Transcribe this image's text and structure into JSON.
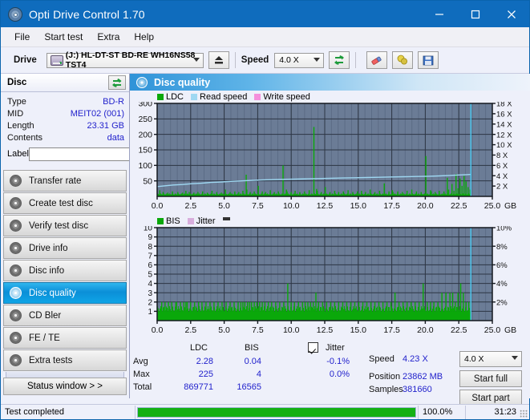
{
  "window": {
    "title": "Opti Drive Control 1.70",
    "icon": "disc-icon",
    "minimize": "minimize-icon",
    "maximize": "maximize-icon",
    "close": "close-icon"
  },
  "menu": {
    "items": [
      "File",
      "Start test",
      "Extra",
      "Help"
    ]
  },
  "toolbar": {
    "drive_label": "Drive",
    "drive_value": "(J:)  HL-DT-ST BD-RE  WH16NS58 TST4",
    "eject_icon": "eject-icon",
    "speed_label": "Speed",
    "speed_value": "4.0 X",
    "refresh_icon": "refresh-icon",
    "erase_icon": "eraser-icon",
    "tools_icon": "bulb-icon",
    "save_icon": "save-icon"
  },
  "disc": {
    "header": "Disc",
    "refresh_icon": "refresh-icon",
    "rows": [
      {
        "key": "Type",
        "value": "BD-R"
      },
      {
        "key": "MID",
        "value": "MEIT02 (001)"
      },
      {
        "key": "Length",
        "value": "23.31 GB"
      },
      {
        "key": "Contents",
        "value": "data"
      }
    ],
    "label_key": "Label",
    "label_value": "",
    "label_placeholder": "",
    "label_button_icon": "cd-icon"
  },
  "nav": {
    "items": [
      {
        "label": "Transfer rate",
        "icon": "disc-icon",
        "active": false
      },
      {
        "label": "Create test disc",
        "icon": "disc-icon",
        "active": false
      },
      {
        "label": "Verify test disc",
        "icon": "disc-icon",
        "active": false
      },
      {
        "label": "Drive info",
        "icon": "disc-icon",
        "active": false
      },
      {
        "label": "Disc info",
        "icon": "disc-icon",
        "active": false
      },
      {
        "label": "Disc quality",
        "icon": "disc-icon",
        "active": true
      },
      {
        "label": "CD Bler",
        "icon": "disc-icon",
        "active": false
      },
      {
        "label": "FE / TE",
        "icon": "disc-icon",
        "active": false
      },
      {
        "label": "Extra tests",
        "icon": "disc-icon",
        "active": false
      }
    ],
    "status_window": "Status window > >"
  },
  "panel": {
    "title": "Disc quality",
    "icon": "disc-icon"
  },
  "chart_data": [
    {
      "type": "line",
      "name": "ldc-chart",
      "title": "",
      "xlabel": "GB",
      "ylabel": "",
      "xlim": [
        0,
        25.0
      ],
      "ylim": [
        0,
        300
      ],
      "y2lim": [
        0,
        18
      ],
      "grid": true,
      "legend_position": "top-left",
      "legend": [
        {
          "label": "LDC",
          "color": "#0aa80a"
        },
        {
          "label": "Read speed",
          "color": "#9fd8f2"
        },
        {
          "label": "Write speed",
          "color": "#f58fdc"
        }
      ],
      "xticks": [
        "0.0",
        "2.5",
        "5.0",
        "7.5",
        "10.0",
        "12.5",
        "15.0",
        "17.5",
        "20.0",
        "22.5",
        "25.0"
      ],
      "yticks": [
        "50",
        "100",
        "150",
        "200",
        "250",
        "300"
      ],
      "y2ticks": [
        "2 X",
        "4 X",
        "6 X",
        "8 X",
        "10 X",
        "12 X",
        "14 X",
        "16 X",
        "18 X"
      ],
      "x_unit": "GB",
      "data_end_gb": 23.4,
      "series": [
        {
          "name": "Read speed",
          "color": "#9fd8f2",
          "axis": "y2",
          "x": [
            0.0,
            0.6,
            1.2,
            1.9,
            2.6,
            3.3,
            4.0,
            4.8,
            5.5,
            6.3,
            7.1,
            7.9,
            8.7,
            9.5,
            10.3,
            11.2,
            12.0,
            12.9,
            13.8,
            14.7,
            15.6,
            16.5,
            17.4,
            18.4,
            19.3,
            20.2,
            21.0,
            21.8,
            22.5,
            23.1,
            23.4
          ],
          "y": [
            1.9,
            2.05,
            2.2,
            2.3,
            2.45,
            2.55,
            2.7,
            2.8,
            2.9,
            3.0,
            3.1,
            3.2,
            3.25,
            3.3,
            3.35,
            3.4,
            3.45,
            3.5,
            3.55,
            3.6,
            3.65,
            3.7,
            3.75,
            3.8,
            3.85,
            3.9,
            3.95,
            4.05,
            4.15,
            4.2,
            4.25
          ]
        },
        {
          "name": "LDC",
          "color": "#0aa80a",
          "axis": "y1",
          "baseline": 6,
          "spikes_x": [
            0.15,
            0.4,
            0.75,
            1.1,
            1.5,
            1.85,
            2.1,
            2.35,
            2.7,
            3.0,
            3.35,
            3.7,
            4.05,
            4.4,
            4.75,
            5.05,
            5.4,
            5.75,
            6.05,
            6.35,
            6.6,
            6.65,
            6.9,
            7.2,
            7.5,
            7.8,
            8.05,
            8.4,
            8.7,
            9.0,
            9.35,
            9.6,
            9.65,
            9.95,
            10.25,
            10.6,
            10.95,
            11.3,
            11.65,
            11.85,
            11.9,
            12.2,
            12.5,
            12.85,
            13.2,
            13.5,
            13.85,
            14.2,
            14.55,
            14.9,
            15.2,
            15.5,
            15.85,
            16.2,
            16.55,
            16.9,
            17.25,
            17.5,
            17.55,
            17.9,
            18.25,
            18.6,
            18.95,
            19.3,
            19.65,
            20.0,
            20.35,
            20.4,
            20.7,
            21.0,
            21.35,
            21.6,
            21.7,
            21.95,
            22.1,
            22.25,
            22.4,
            22.55,
            22.7,
            22.85,
            23.0,
            23.15,
            23.3
          ],
          "spikes_y": [
            20,
            14,
            12,
            16,
            14,
            12,
            18,
            14,
            12,
            14,
            16,
            12,
            18,
            14,
            12,
            22,
            14,
            16,
            14,
            18,
            70,
            22,
            14,
            16,
            34,
            16,
            14,
            20,
            14,
            16,
            100,
            22,
            16,
            14,
            18,
            14,
            16,
            20,
            224,
            24,
            18,
            14,
            30,
            14,
            18,
            14,
            16,
            20,
            14,
            16,
            18,
            14,
            22,
            14,
            18,
            42,
            16,
            20,
            14,
            16,
            14,
            18,
            22,
            16,
            14,
            130,
            20,
            16,
            14,
            18,
            16,
            60,
            22,
            40,
            18,
            72,
            26,
            58,
            34,
            66,
            48,
            30,
            22
          ]
        }
      ],
      "cursor_x": 23.4,
      "cursor_color": "#4cc8f0"
    },
    {
      "type": "line",
      "name": "bis-chart",
      "title": "",
      "xlabel": "GB",
      "ylabel": "",
      "xlim": [
        0,
        25.0
      ],
      "ylim": [
        0,
        10
      ],
      "y2lim": [
        0,
        10
      ],
      "grid": true,
      "legend_position": "top-left",
      "legend": [
        {
          "label": "BIS",
          "color": "#0aa80a"
        },
        {
          "label": "Jitter",
          "color": "#d8aedd"
        }
      ],
      "xticks": [
        "0.0",
        "2.5",
        "5.0",
        "7.5",
        "10.0",
        "12.5",
        "15.0",
        "17.5",
        "20.0",
        "22.5",
        "25.0"
      ],
      "yticks": [
        "1",
        "2",
        "3",
        "4",
        "5",
        "6",
        "7",
        "8",
        "9",
        "10"
      ],
      "y2ticks": [
        "2%",
        "4%",
        "6%",
        "8%",
        "10%"
      ],
      "x_unit": "GB",
      "data_end_gb": 23.4,
      "series": [
        {
          "name": "BIS",
          "color": "#0aa80a",
          "axis": "y1",
          "baseline": 1.0,
          "spikes_x": [
            0.3,
            0.55,
            0.8,
            1.05,
            1.35,
            1.4,
            1.7,
            1.95,
            2.1,
            2.2,
            2.45,
            2.75,
            3.05,
            3.3,
            3.6,
            3.9,
            4.2,
            4.5,
            4.8,
            5.1,
            5.4,
            5.7,
            6.0,
            6.2,
            6.35,
            6.5,
            6.7,
            6.85,
            7.0,
            7.2,
            7.4,
            7.6,
            7.8,
            8.0,
            8.25,
            8.5,
            8.8,
            9.1,
            9.4,
            9.7,
            9.95,
            10.2,
            10.5,
            10.8,
            11.0,
            11.2,
            11.4,
            11.6,
            11.8,
            12.0,
            12.3,
            12.6,
            12.9,
            13.2,
            13.5,
            13.8,
            14.1,
            14.4,
            14.7,
            15.0,
            15.3,
            15.6,
            15.9,
            16.2,
            16.5,
            16.8,
            17.1,
            17.4,
            17.7,
            18.0,
            18.3,
            18.6,
            18.9,
            19.2,
            19.5,
            19.8,
            20.1,
            20.35,
            20.6,
            20.9,
            21.2,
            21.5,
            21.8,
            22.0,
            22.2,
            22.4,
            22.6,
            22.8,
            23.0,
            23.2,
            23.35
          ],
          "spikes_y": [
            2,
            2,
            2,
            2,
            2,
            2,
            2,
            2,
            2,
            2,
            2,
            2,
            2,
            2,
            2,
            2,
            2,
            2,
            2,
            2,
            2,
            2,
            2,
            2,
            2,
            2,
            2,
            2,
            2,
            2,
            2,
            2,
            2,
            2,
            2,
            2,
            2,
            2,
            2,
            4,
            2,
            2,
            2,
            2,
            2,
            2,
            2,
            2,
            3,
            2,
            2,
            2,
            2,
            2,
            2,
            2,
            2,
            2,
            2,
            2,
            2,
            2,
            2,
            2,
            2,
            2,
            2,
            2,
            3,
            2,
            2,
            2,
            2,
            2,
            2,
            4,
            2,
            2,
            2,
            2,
            3,
            3,
            3,
            3,
            2,
            3,
            4,
            3,
            2,
            2,
            2
          ]
        }
      ],
      "cursor_x": 23.4,
      "cursor_color": "#4cc8f0"
    }
  ],
  "stats": {
    "col_ldc": "LDC",
    "col_bis": "BIS",
    "col_jitter": "Jitter",
    "jitter_checked": true,
    "rows": [
      {
        "label": "Avg",
        "ldc": "2.28",
        "bis": "0.04",
        "jitter": "-0.1%"
      },
      {
        "label": "Max",
        "ldc": "225",
        "bis": "4",
        "jitter": "0.0%"
      },
      {
        "label": "Total",
        "ldc": "869771",
        "bis": "16565",
        "jitter": ""
      }
    ],
    "speed_label": "Speed",
    "speed_value": "4.23 X",
    "speed_select": "4.0 X",
    "position_label": "Position",
    "position_value": "23862 MB",
    "samples_label": "Samples",
    "samples_value": "381660",
    "start_full": "Start full",
    "start_part": "Start part"
  },
  "statusbar": {
    "message": "Test completed",
    "progress_pct": 100.0,
    "progress_text": "100.0%",
    "elapsed": "31:23"
  },
  "colors": {
    "accent": "#0f6cbd",
    "plot_bg": "#6b7c96",
    "green": "#0aa80a",
    "read_speed": "#9fd8f2",
    "write_speed": "#f58fdc",
    "jitter": "#d8aedd",
    "cursor": "#4cc8f0",
    "value_blue": "#2222cc"
  }
}
